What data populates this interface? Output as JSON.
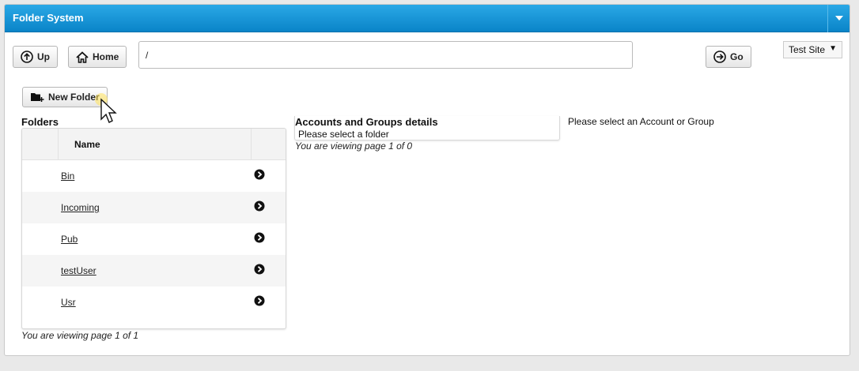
{
  "titlebar": {
    "title": "Folder System"
  },
  "toolbar": {
    "up_label": "Up",
    "home_label": "Home",
    "path_value": "/",
    "go_label": "Go",
    "site_selected": "Test Site",
    "new_folder_label": "New Folder"
  },
  "folders": {
    "heading": "Folders",
    "column_name": "Name",
    "items": [
      {
        "name": "Bin"
      },
      {
        "name": "Incoming"
      },
      {
        "name": "Pub"
      },
      {
        "name": "testUser"
      },
      {
        "name": "Usr"
      }
    ],
    "pager": "You are viewing page 1 of 1"
  },
  "details": {
    "heading": "Accounts and Groups details",
    "placeholder": "Please select a folder",
    "pager": "You are viewing page 1 of 0"
  },
  "account_hint": "Please select an Account or Group",
  "colors": {
    "titlebar": "#1596d8",
    "accent": "#0a84c8"
  }
}
